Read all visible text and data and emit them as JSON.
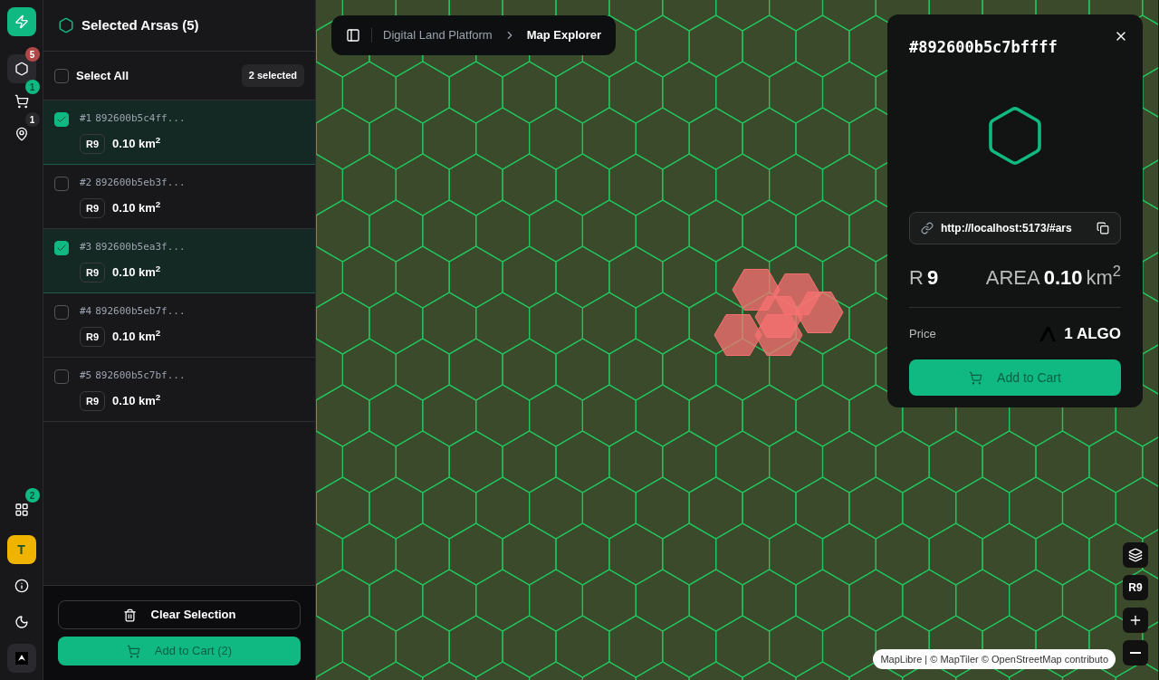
{
  "rail": {
    "items": [
      {
        "kind": "hexagon",
        "badge": "5",
        "selected": true
      },
      {
        "kind": "cart",
        "badge": "1",
        "selected": false
      },
      {
        "kind": "pin",
        "badge": "1",
        "selected": false
      }
    ],
    "bottom_items": [
      {
        "kind": "grid",
        "badge": "2"
      }
    ],
    "avatar": "T"
  },
  "panel": {
    "title": "Selected Arsas (5)",
    "select_all": {
      "label": "Select All",
      "checked": false
    },
    "selected_count": "2 selected",
    "items": [
      {
        "index": "#1",
        "id": "892600b5c4ff...",
        "resolution": "R9",
        "area": "0.10 km$^{2}$",
        "checked": true
      },
      {
        "index": "#2",
        "id": "892600b5eb3f...",
        "resolution": "R9",
        "area": "0.10 km$^{2}$",
        "checked": false
      },
      {
        "index": "#3",
        "id": "892600b5ea3f...",
        "resolution": "R9",
        "area": "0.10 km$^{2}$",
        "checked": true
      },
      {
        "index": "#4",
        "id": "892600b5eb7f...",
        "resolution": "R9",
        "area": "0.10 km$^{2}$",
        "checked": false
      },
      {
        "index": "#5",
        "id": "892600b5c7bf...",
        "resolution": "R9",
        "area": "0.10 km$^{2}$",
        "checked": false
      }
    ],
    "clear_button": "Clear Selection",
    "add_button": "Add to Cart (2)"
  },
  "breadcrumb": [
    "Digital Land Platform",
    "Map Explorer"
  ],
  "detail": {
    "title": "#892600b5c7bffff",
    "link": "http://localhost:5173/#ars",
    "resolution_label": "R",
    "resolution": "9",
    "area_label": "AREA",
    "area_value": "0.10",
    "area_unit": "km$^{2}$",
    "price_label": "Price",
    "price": "1 ALGO",
    "add_button": "Add to Cart"
  },
  "map_controls": {
    "resolution": "R9"
  },
  "attribution": "MapLibre | © MapTiler © OpenStreetMap contributo"
}
